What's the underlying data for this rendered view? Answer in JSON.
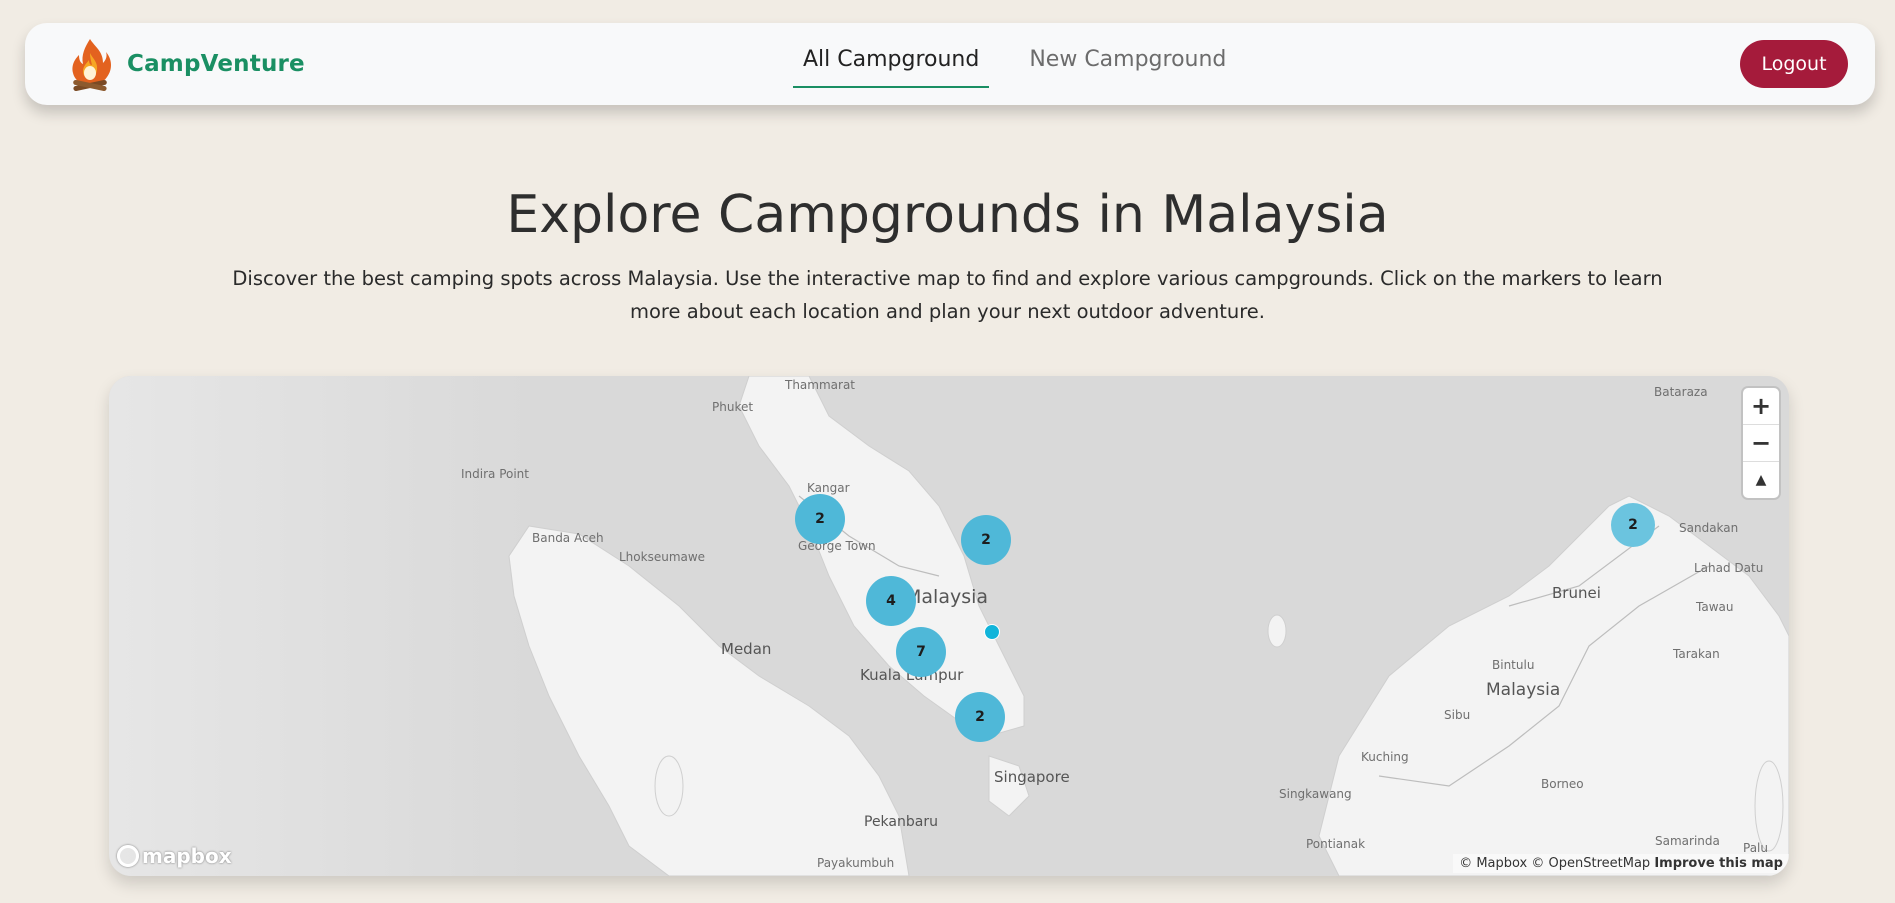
{
  "navbar": {
    "brand": "CampVenture",
    "links": [
      "All Campground",
      "New Campground"
    ],
    "logout": "Logout"
  },
  "hero": {
    "title": "Explore Campgrounds in Malaysia",
    "description": "Discover the best camping spots across Malaysia. Use the interactive map to find and explore various campgrounds. Click on the markers to learn more about each location and plan your next outdoor adventure."
  },
  "map": {
    "labels": {
      "thammarat": "Thammarat",
      "phuket": "Phuket",
      "indira_point": "Indira Point",
      "kangar": "Kangar",
      "banda_aceh": "Banda Aceh",
      "lhokseumawe": "Lhokseumawe",
      "george_town": "George Town",
      "malaysia_peninsula": "Malaysia",
      "medan": "Medan",
      "kuala_lumpur": "Kuala Lumpur",
      "singapore": "Singapore",
      "pekanbaru": "Pekanbaru",
      "payakumbuh": "Payakumbuh",
      "bataraza": "Bataraza",
      "sandakan": "Sandakan",
      "lahad_datu": "Lahad Datu",
      "brunei": "Brunei",
      "tawau": "Tawau",
      "tarakan": "Tarakan",
      "bintulu": "Bintulu",
      "malaysia_borneo": "Malaysia",
      "sibu": "Sibu",
      "kuching": "Kuching",
      "singkawang": "Singkawang",
      "borneo": "Borneo",
      "pontianak": "Pontianak",
      "samarinda": "Samarinda",
      "palu": "Palu"
    },
    "clusters": {
      "penang": "2",
      "kelantan": "2",
      "perak": "4",
      "selangor": "7",
      "johor": "2",
      "sabah": "2"
    },
    "controls": {
      "zoom_in": "+",
      "zoom_out": "−",
      "compass": "▲"
    },
    "logo": "mapbox",
    "attribution": {
      "text": "© Mapbox © OpenStreetMap",
      "improve": "Improve this map"
    }
  },
  "colors": {
    "background": "#f1ece4",
    "brand": "#1a8f63",
    "logout": "#a51b3b",
    "cluster": "#4fb8d8",
    "marker": "#11b4da"
  }
}
